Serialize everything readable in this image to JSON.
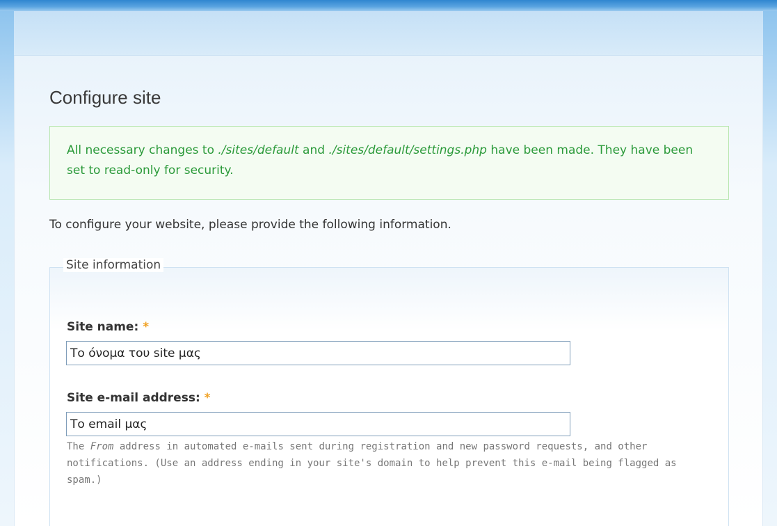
{
  "page": {
    "title": "Configure site"
  },
  "status": {
    "part1": "All necessary changes to ",
    "path1": "./sites/default",
    "part2": " and ",
    "path2": "./sites/default/settings.php",
    "part3": " have been made. They have been set to read-only for security."
  },
  "intro": "To configure your website, please provide the following information.",
  "fieldset": {
    "legend": "Site information",
    "site_name": {
      "label": "Site name: ",
      "required": "*",
      "value": "Το όνομα του site μας"
    },
    "site_email": {
      "label": "Site e-mail address: ",
      "required": "*",
      "value": "Το email μας",
      "description_part1": "The ",
      "description_from": "From",
      "description_part2": " address in automated e-mails sent during registration and new password requests, and other notifications. (Use an address ending in your site's domain to help prevent this e-mail being flagged as spam.)"
    }
  },
  "colors": {
    "status_text": "#2b9a3a",
    "status_border": "#b8e6b0",
    "required": "#f0a020",
    "header_blue": "#2f86d0"
  }
}
